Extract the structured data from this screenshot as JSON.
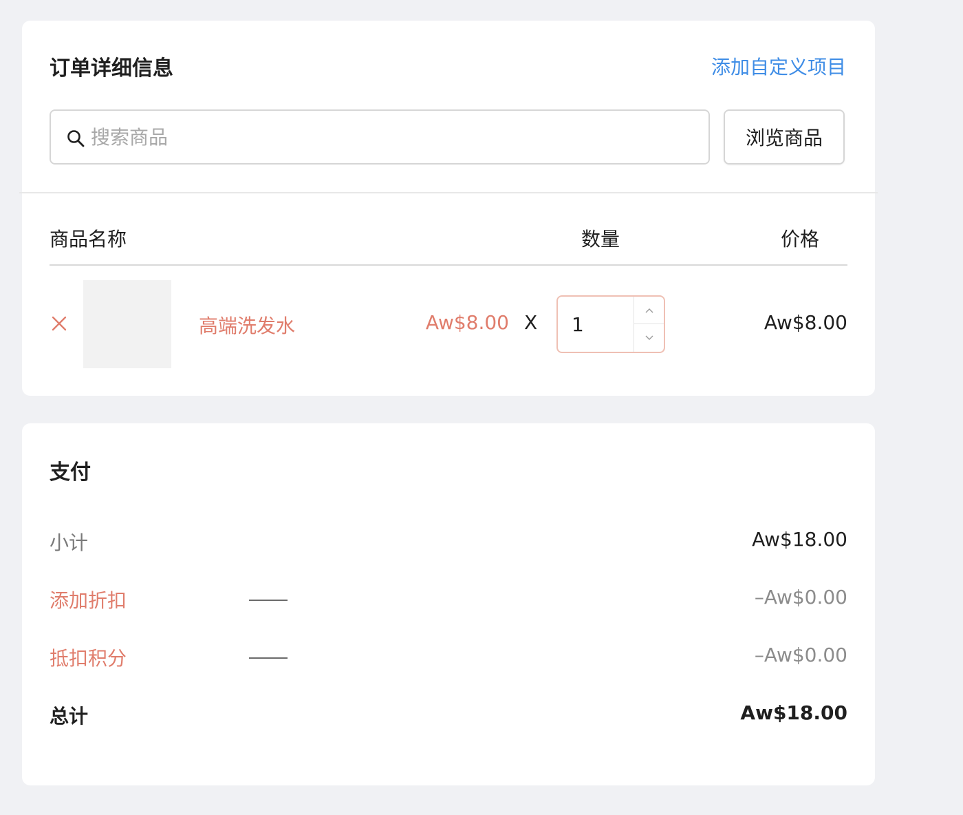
{
  "order": {
    "title": "订单详细信息",
    "add_custom_item": "添加自定义项目",
    "search": {
      "placeholder": "搜索商品",
      "value": ""
    },
    "browse_button": "浏览商品",
    "columns": {
      "name": "商品名称",
      "quantity": "数量",
      "price": "价格"
    },
    "items": [
      {
        "name": "高端洗发水",
        "unit_price": "Aw$8.00",
        "times": "X",
        "quantity": "1",
        "line_total": "Aw$8.00"
      }
    ]
  },
  "payment": {
    "title": "支付",
    "subtotal_label": "小计",
    "subtotal_value": "Aw$18.00",
    "discount_label": "添加折扣",
    "discount_value": "–Aw$0.00",
    "points_label": "抵扣积分",
    "points_value": "–Aw$0.00",
    "total_label": "总计",
    "total_value": "Aw$18.00"
  },
  "colors": {
    "link": "#3f8de6",
    "accent": "#e07d6c",
    "stepper_border": "#efc0b4",
    "background": "#f0f1f4"
  },
  "icons": {
    "search": "search-icon",
    "remove": "close-icon",
    "qty_up": "chevron-up-icon",
    "qty_down": "chevron-down-icon"
  }
}
